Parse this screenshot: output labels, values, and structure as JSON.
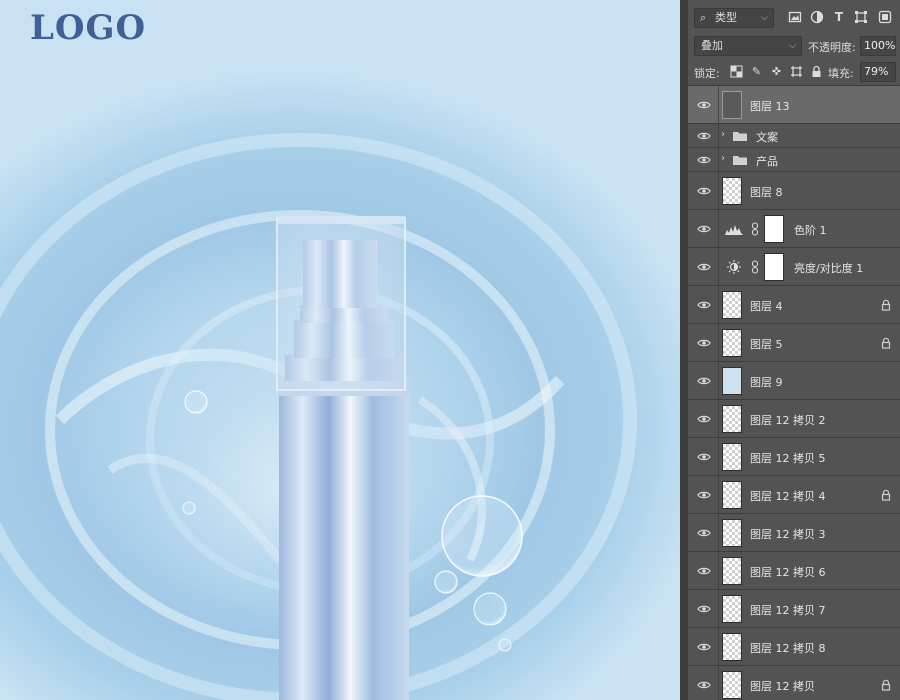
{
  "canvas": {
    "logo_text": "LOGO"
  },
  "panel": {
    "filter_icon": "search-icon",
    "filter_value": "类型",
    "filter_icons": [
      "image-filter-icon",
      "adjustment-filter-icon",
      "type-filter-icon",
      "shape-filter-icon",
      "smart-object-filter-icon"
    ],
    "blend_mode": "叠加",
    "opacity_label": "不透明度:",
    "opacity_value": "100%",
    "lock_label": "锁定:",
    "lock_icons": [
      "lock-transparent-icon",
      "lock-image-icon",
      "lock-position-icon",
      "lock-artboard-icon",
      "lock-all-icon"
    ],
    "fill_label": "填充:",
    "fill_value": "79%"
  },
  "layers": [
    {
      "name": "图层 13",
      "kind": "pixel",
      "thumb": "dark",
      "selected": true,
      "locked": false
    },
    {
      "name": "文案",
      "kind": "group",
      "selected": false,
      "locked": false
    },
    {
      "name": "产品",
      "kind": "group",
      "selected": false,
      "locked": false
    },
    {
      "name": "图层 8",
      "kind": "pixel",
      "thumb": "transparent",
      "selected": false,
      "locked": false
    },
    {
      "name": "色阶 1",
      "kind": "adjustment",
      "icon": "levels-icon",
      "selected": false,
      "locked": false
    },
    {
      "name": "亮度/对比度 1",
      "kind": "adjustment",
      "icon": "brightness-icon",
      "selected": false,
      "locked": false
    },
    {
      "name": "图层 4",
      "kind": "pixel",
      "thumb": "transparent",
      "selected": false,
      "locked": true
    },
    {
      "name": "图层 5",
      "kind": "pixel",
      "thumb": "transparent",
      "selected": false,
      "locked": true
    },
    {
      "name": "图层 9",
      "kind": "pixel",
      "thumb": "blue",
      "selected": false,
      "locked": false
    },
    {
      "name": "图层 12 拷贝 2",
      "kind": "pixel",
      "thumb": "transparent",
      "selected": false,
      "locked": false
    },
    {
      "name": "图层 12 拷贝 5",
      "kind": "pixel",
      "thumb": "transparent",
      "selected": false,
      "locked": false
    },
    {
      "name": "图层 12 拷贝 4",
      "kind": "pixel",
      "thumb": "transparent",
      "selected": false,
      "locked": true
    },
    {
      "name": "图层 12 拷贝 3",
      "kind": "pixel",
      "thumb": "transparent",
      "selected": false,
      "locked": false
    },
    {
      "name": "图层 12 拷贝 6",
      "kind": "pixel",
      "thumb": "transparent",
      "selected": false,
      "locked": false
    },
    {
      "name": "图层 12 拷贝 7",
      "kind": "pixel",
      "thumb": "transparent",
      "selected": false,
      "locked": false
    },
    {
      "name": "图层 12 拷贝 8",
      "kind": "pixel",
      "thumb": "transparent",
      "selected": false,
      "locked": false
    },
    {
      "name": "图层 12 拷贝",
      "kind": "pixel",
      "thumb": "transparent",
      "selected": false,
      "locked": true
    }
  ],
  "colors": {
    "panel_bg": "#535353",
    "selected_row": "#6a6a6a",
    "logo": "#3f5f95",
    "canvas_blue": "#a9d0ea"
  }
}
